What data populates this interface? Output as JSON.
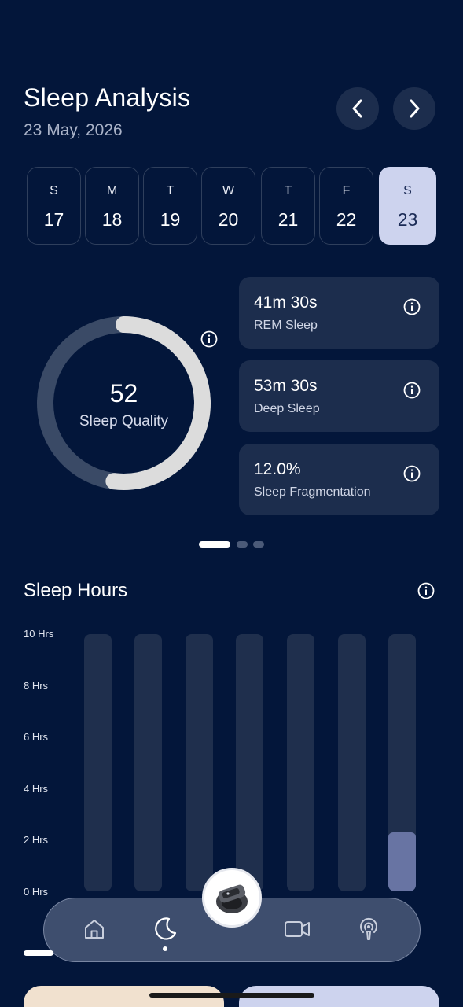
{
  "header": {
    "title": "Sleep Analysis",
    "date": "23 May, 2026"
  },
  "days": [
    {
      "letter": "S",
      "num": "17"
    },
    {
      "letter": "M",
      "num": "18"
    },
    {
      "letter": "T",
      "num": "19"
    },
    {
      "letter": "W",
      "num": "20"
    },
    {
      "letter": "T",
      "num": "21"
    },
    {
      "letter": "F",
      "num": "22"
    },
    {
      "letter": "S",
      "num": "23",
      "selected": true
    }
  ],
  "quality": {
    "score": "52",
    "label": "Sleep Quality",
    "fraction": 0.52
  },
  "metrics": [
    {
      "value": "41m 30s",
      "label": "REM Sleep"
    },
    {
      "value": "53m 30s",
      "label": "Deep Sleep"
    },
    {
      "value": "12.0%",
      "label": "Sleep Fragmentation"
    }
  ],
  "pager": {
    "count": 3,
    "active": 0
  },
  "sleep_hours": {
    "title": "Sleep Hours",
    "y_ticks": [
      "10 Hrs",
      "8 Hrs",
      "6 Hrs",
      "4 Hrs",
      "2 Hrs",
      "0 Hrs"
    ]
  },
  "chart_data": {
    "type": "bar",
    "title": "Sleep Hours",
    "categories": [
      "17",
      "18",
      "19",
      "20",
      "21",
      "22",
      "23"
    ],
    "values": [
      0,
      0,
      0,
      0,
      0,
      0,
      2.3
    ],
    "ylim": [
      0,
      10
    ],
    "ytick_labels": [
      "10 Hrs",
      "8 Hrs",
      "6 Hrs",
      "4 Hrs",
      "2 Hrs",
      "0 Hrs"
    ]
  },
  "nav": {
    "items": [
      "home-icon",
      "moon-icon",
      "ring-device",
      "video-icon",
      "podcast-icon"
    ],
    "active": "moon-icon"
  },
  "colors": {
    "background": "#03163a",
    "card": "#1c2d4d",
    "ring_fill": "#dcdcdc",
    "ring_track": "#3a4a66",
    "selected_day": "#cdd3ee",
    "bar_fill": "#6874a3"
  }
}
